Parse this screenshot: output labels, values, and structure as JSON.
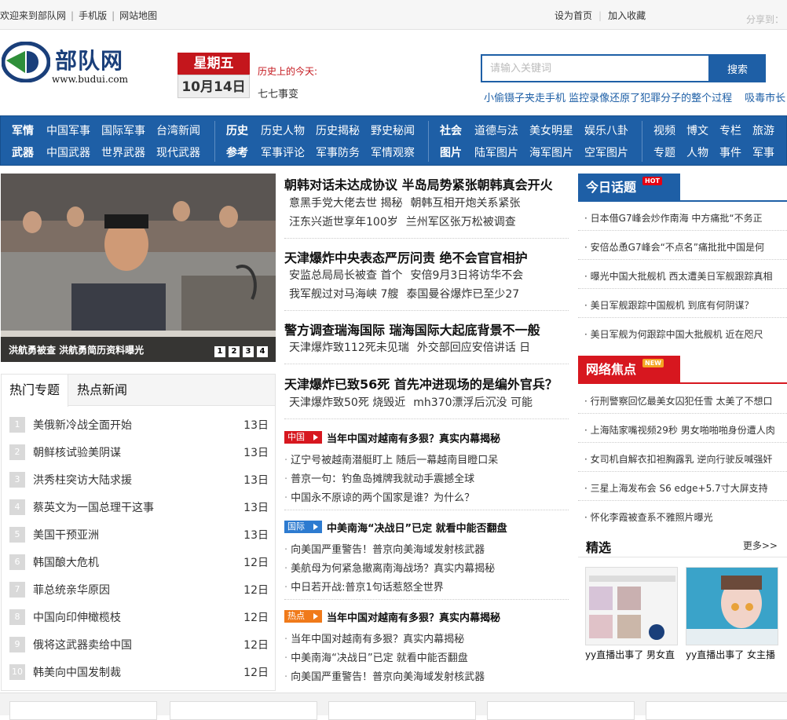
{
  "topbar": {
    "welcome": "欢迎来到部队网",
    "mobile": "手机版",
    "sitemap": "网站地图",
    "set_home": "设为首页",
    "add_fav": "加入收藏",
    "share": "分享到："
  },
  "logo": {
    "name": "部队网",
    "url": "www.budui.com"
  },
  "date": {
    "weekday": "星期五",
    "day": "10月14日"
  },
  "history": {
    "label": "历史上的今天:",
    "item": "七七事变"
  },
  "search": {
    "placeholder": "请输入关键词",
    "button": "搜索"
  },
  "hotwords": [
    "小偷镊子夹走手机 监控录像还原了犯罪分子的整个过程",
    "吸毒市长"
  ],
  "nav": {
    "g1": {
      "h1": "军情",
      "r1": [
        "中国军事",
        "国际军事",
        "台湾新闻"
      ],
      "h2": "武器",
      "r2": [
        "中国武器",
        "世界武器",
        "现代武器"
      ]
    },
    "g2": {
      "h1": "历史",
      "r1": [
        "历史人物",
        "历史揭秘",
        "野史秘闻"
      ],
      "h2": "参考",
      "r2": [
        "军事评论",
        "军事防务",
        "军情观察"
      ]
    },
    "g3": {
      "h1": "社会",
      "r1": [
        "道德与法",
        "美女明星",
        "娱乐八卦"
      ],
      "h2": "图片",
      "r2": [
        "陆军图片",
        "海军图片",
        "空军图片"
      ]
    },
    "g4": {
      "r1": [
        "视频",
        "博文",
        "专栏",
        "旅游"
      ],
      "r2": [
        "专题",
        "人物",
        "事件",
        "军事"
      ]
    }
  },
  "focus": {
    "caption": "洪航勇被查 洪航勇简历资料曝光",
    "pages": [
      "1",
      "2",
      "3",
      "4"
    ]
  },
  "tabs": {
    "t1": "热门专题",
    "t2": "热点新闻"
  },
  "rank": [
    {
      "n": "1",
      "t": "美俄新冷战全面开始",
      "d": "13日"
    },
    {
      "n": "2",
      "t": "朝鲜核试验美阴谋",
      "d": "13日"
    },
    {
      "n": "3",
      "t": "洪秀柱突访大陆求援",
      "d": "13日"
    },
    {
      "n": "4",
      "t": "蔡英文为一国总理干这事",
      "d": "13日"
    },
    {
      "n": "5",
      "t": "美国干预亚洲",
      "d": "13日"
    },
    {
      "n": "6",
      "t": "韩国酿大危机",
      "d": "12日"
    },
    {
      "n": "7",
      "t": "菲总统亲华原因",
      "d": "12日"
    },
    {
      "n": "8",
      "t": "中国向印伸橄榄枝",
      "d": "12日"
    },
    {
      "n": "9",
      "t": "俄将这武器卖给中国",
      "d": "12日"
    },
    {
      "n": "10",
      "t": "韩美向中国发制裁",
      "d": "12日"
    }
  ],
  "headlines": [
    {
      "title": "朝韩对话未达成协议 半岛局势紧张朝韩真会开火",
      "s1": [
        "意黑手党大佬去世 揭秘",
        "朝韩互相开炮关系紧张"
      ],
      "s2": [
        "汪东兴逝世享年100岁",
        "兰州军区张万松被调查"
      ]
    },
    {
      "title": "天津爆炸中央表态严厉问责 绝不会官官相护",
      "s1": [
        "安监总局局长被查 首个",
        "安倍9月3日将访华不会"
      ],
      "s2": [
        "我军舰过对马海峡 7艘",
        "泰国曼谷爆炸已至少27"
      ]
    },
    {
      "title": "警方调查瑞海国际 瑞海国际大起底背景不一般",
      "s1": [
        "天津爆炸致112死未见瑞",
        "外交部回应安倍讲话 日"
      ]
    },
    {
      "title": "天津爆炸已致56死 首先冲进现场的是编外官兵？",
      "s1": [
        "天津爆炸致50死 烧毁近",
        "mh370漂浮后沉没 可能"
      ]
    }
  ],
  "cats": [
    {
      "tag": "中国",
      "color": "#d7171f",
      "title": "当年中国对越南有多狠？真实内幕揭秘",
      "items": [
        "辽宁号被越南潜艇盯上 随后一幕越南目瞪口呆",
        "普京一句：钓鱼岛摊牌我就动手震撼全球",
        "中国永不原谅的两个国家是谁？为什么？"
      ]
    },
    {
      "tag": "国际",
      "color": "#2d7bd0",
      "title": "中美南海“决战日”已定 就看中能否翻盘",
      "items": [
        "向美国严重警告！普京向美海域发射核武器",
        "美航母为何紧急撤离南海战场？真实内幕揭秘",
        "中日若开战:普京1句话惹怒全世界"
      ]
    },
    {
      "tag": "热点",
      "color": "#f07a1a",
      "title": "当年中国对越南有多狠？真实内幕揭秘",
      "items": [
        "当年中国对越南有多狠？真实内幕揭秘",
        "中美南海“决战日”已定 就看中能否翻盘",
        "向美国严重警告！普京向美海域发射核武器"
      ]
    }
  ],
  "today": {
    "label": "今日话题",
    "badge": "HOT",
    "items": [
      "日本借G7峰会炒作南海 中方痛批“不务正",
      "安倍怂恿G7峰会“不点名”痛批批中国是何",
      "曝光中国大批舰机 西太遭美日军舰跟踪真相",
      "美日军舰跟踪中国舰机 到底有何阴谋？",
      "美日军舰为何跟踪中国大批舰机 近在咫尺"
    ]
  },
  "network": {
    "label": "网络焦点",
    "badge": "NEW",
    "items": [
      "行刑警察回忆最美女囚犯任雪 太美了不想口",
      "上海陆家嘴视频29秒 男女啪啪啪身份遭人肉",
      "女司机自解衣扣袒胸露乳 逆向行驶反喊强奸",
      "三星上海发布会 S6 edge+5.7寸大屏支持",
      "怀化李霞被查系不雅照片曝光"
    ]
  },
  "picks": {
    "label": "精选",
    "more": "更多>>",
    "c1": "yy直播出事了 男女直",
    "c2": "yy直播出事了 女主播"
  },
  "colors": {
    "brand_blue": "#1e5fa6",
    "red": "#c4161c"
  }
}
